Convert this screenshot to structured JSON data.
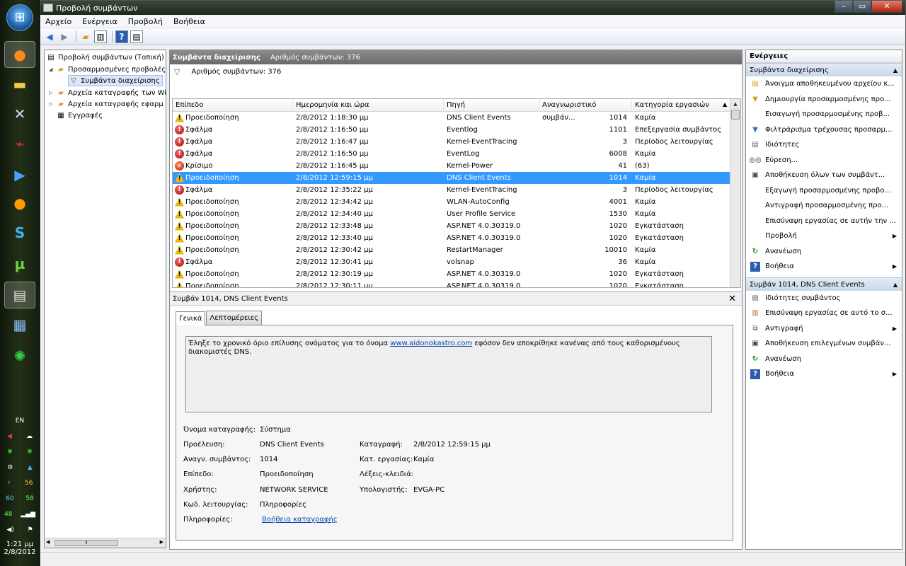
{
  "window": {
    "title": "Προβολή συμβάντων"
  },
  "menu": [
    "Αρχείο",
    "Ενέργεια",
    "Προβολή",
    "Βοήθεια"
  ],
  "tree": [
    {
      "label": "Προβολή συμβάντων (Τοπική)"
    },
    {
      "label": "Προσαρμοσμένες προβολές"
    },
    {
      "label": "Συμβάντα διαχείρισης"
    },
    {
      "label": "Αρχεία καταγραφής των Wi"
    },
    {
      "label": "Αρχεία καταγραφής εφαρμ"
    },
    {
      "label": "Εγγραφές"
    }
  ],
  "center": {
    "header_title": "Συμβάντα διαχείρισης",
    "header_count": "Αριθμός συμβάντων: 376",
    "filter_text": "Αριθμός συμβάντων: 376",
    "columns": [
      "Επίπεδο",
      "Ημερομηνία και ώρα",
      "Πηγή",
      "Αναγνωριστικό συμβάν...",
      "Κατηγορία εργασιών"
    ],
    "rows": [
      {
        "icon": "warning-icon",
        "level": "Προειδοποίηση",
        "date": "2/8/2012 1:18:30 μμ",
        "source": "DNS Client Events",
        "id": "1014",
        "category": "Καμία"
      },
      {
        "icon": "error-icon",
        "level": "Σφάλμα",
        "date": "2/8/2012 1:16:50 μμ",
        "source": "Eventlog",
        "id": "1101",
        "category": "Επεξεργασία συμβάντος"
      },
      {
        "icon": "error-icon",
        "level": "Σφάλμα",
        "date": "2/8/2012 1:16:47 μμ",
        "source": "Kernel-EventTracing",
        "id": "3",
        "category": "Περίοδος λειτουργίας"
      },
      {
        "icon": "error-icon",
        "level": "Σφάλμα",
        "date": "2/8/2012 1:16:50 μμ",
        "source": "EventLog",
        "id": "6008",
        "category": "Καμία"
      },
      {
        "icon": "critical-icon",
        "level": "Κρίσιμο",
        "date": "2/8/2012 1:16:45 μμ",
        "source": "Kernel-Power",
        "id": "41",
        "category": "(63)"
      },
      {
        "icon": "warning-icon",
        "level": "Προειδοποίηση",
        "date": "2/8/2012 12:59:15 μμ",
        "source": "DNS Client Events",
        "id": "1014",
        "category": "Καμία"
      },
      {
        "icon": "error-icon",
        "level": "Σφάλμα",
        "date": "2/8/2012 12:35:22 μμ",
        "source": "Kernel-EventTracing",
        "id": "3",
        "category": "Περίοδος λειτουργίας"
      },
      {
        "icon": "warning-icon",
        "level": "Προειδοποίηση",
        "date": "2/8/2012 12:34:42 μμ",
        "source": "WLAN-AutoConfig",
        "id": "4001",
        "category": "Καμία"
      },
      {
        "icon": "warning-icon",
        "level": "Προειδοποίηση",
        "date": "2/8/2012 12:34:40 μμ",
        "source": "User Profile Service",
        "id": "1530",
        "category": "Καμία"
      },
      {
        "icon": "warning-icon",
        "level": "Προειδοποίηση",
        "date": "2/8/2012 12:33:48 μμ",
        "source": "ASP.NET 4.0.30319.0",
        "id": "1020",
        "category": "Εγκατάσταση"
      },
      {
        "icon": "warning-icon",
        "level": "Προειδοποίηση",
        "date": "2/8/2012 12:33:40 μμ",
        "source": "ASP.NET 4.0.30319.0",
        "id": "1020",
        "category": "Εγκατάσταση"
      },
      {
        "icon": "warning-icon",
        "level": "Προειδοποίηση",
        "date": "2/8/2012 12:30:42 μμ",
        "source": "RestartManager",
        "id": "10010",
        "category": "Καμία"
      },
      {
        "icon": "error-icon",
        "level": "Σφάλμα",
        "date": "2/8/2012 12:30:41 μμ",
        "source": "volsnap",
        "id": "36",
        "category": "Καμία"
      },
      {
        "icon": "warning-icon",
        "level": "Προειδοποίηση",
        "date": "2/8/2012 12:30:19 μμ",
        "source": "ASP.NET 4.0.30319.0",
        "id": "1020",
        "category": "Εγκατάσταση"
      },
      {
        "icon": "warning-icon",
        "level": "Προειδοποίηση",
        "date": "2/8/2012 12:30:11 μμ",
        "source": "ASP.NET 4.0.30319.0",
        "id": "1020",
        "category": "Εγκατάσταση"
      }
    ],
    "selected_row": 5
  },
  "detail": {
    "title": "Συμβάν 1014, DNS Client Events",
    "tabs": [
      "Γενικά",
      "Λεπτομέρειες"
    ],
    "desc_before": "Έληξε το χρονικό όριο επίλυσης ονόματος για το όνομα ",
    "desc_link": "www.aidonokastro.com",
    "desc_after": " εφόσον δεν αποκρίθηκε κανένας από τους καθορισμένους διακομιστές DNS.",
    "log_name_label": "Όνομα καταγραφής:",
    "log_name": "Σύστημα",
    "source_label": "Προέλευση:",
    "source": "DNS Client Events",
    "logged_label": "Καταγραφή:",
    "logged": "2/8/2012 12:59:15 μμ",
    "event_id_label": "Αναγν. συμβάντος:",
    "event_id": "1014",
    "task_label": "Κατ. εργασίας:",
    "task": "Καμία",
    "level_label": "Επίπεδο:",
    "level": "Προειδοποίηση",
    "keywords_label": "Λέξεις-κλειδιά:",
    "user_label": "Χρήστης:",
    "user": "NETWORK SERVICE",
    "computer_label": "Υπολογιστής:",
    "computer": "EVGA-PC",
    "opcode_label": "Κωδ. λειτουργίας:",
    "opcode": "Πληροφορίες",
    "info_label": "Πληροφορίες:",
    "info_link": "Βοήθεια καταγραφής"
  },
  "actions": {
    "title": "Ενέργειες",
    "section1": "Συμβάντα διαχείρισης",
    "items1": [
      {
        "icon": "open-log-icon",
        "label": "Άνοιγμα αποθηκευμένου αρχείου κ..."
      },
      {
        "icon": "filter-create-icon",
        "label": "Δημιουργία προσαρμοσμένης προ..."
      },
      {
        "icon": "none",
        "label": "Εισαγωγή προσαρμοσμένης προβ..."
      },
      {
        "icon": "filter-icon",
        "label": "Φιλτράρισμα τρέχουσας προσαρμ..."
      },
      {
        "icon": "properties-icon",
        "label": "Ιδιότητες"
      },
      {
        "icon": "binoculars-icon",
        "label": "Εύρεση..."
      },
      {
        "icon": "save-icon",
        "label": "Αποθήκευση όλων των συμβάντ..."
      },
      {
        "icon": "none",
        "label": "Εξαγωγή προσαρμοσμένης προβο..."
      },
      {
        "icon": "none",
        "label": "Αντιγραφή προσαρμοσμένης προ..."
      },
      {
        "icon": "none",
        "label": "Επισύναψη εργασίας σε αυτήν την ..."
      },
      {
        "icon": "none",
        "label": "Προβολή",
        "submenu": true
      },
      {
        "icon": "refresh-icon",
        "label": "Ανανέωση"
      },
      {
        "icon": "help-icon",
        "label": "Βοήθεια",
        "submenu": true
      }
    ],
    "section2": "Συμβάν 1014, DNS Client Events",
    "items2": [
      {
        "icon": "properties-icon",
        "label": "Ιδιότητες συμβάντος"
      },
      {
        "icon": "task-icon",
        "label": "Επισύναψη εργασίας σε αυτό το σ..."
      },
      {
        "icon": "copy-icon",
        "label": "Αντιγραφή",
        "submenu": true
      },
      {
        "icon": "save-icon",
        "label": "Αποθήκευση επιλεγμένων συμβάν..."
      },
      {
        "icon": "refresh-icon",
        "label": "Ανανέωση"
      },
      {
        "icon": "help-icon",
        "label": "Βοήθεια",
        "submenu": true
      }
    ]
  },
  "taskbar": {
    "language": "EN",
    "tray_numbers": [
      "56",
      "60",
      "58",
      "48"
    ],
    "clock_time": "1:21 μμ",
    "clock_date": "2/8/2012"
  },
  "colors": {
    "selection": "#3399ff",
    "link": "#0645ad",
    "header_gray": "#6a6a6a",
    "section_blue": "#c9d8ea"
  }
}
